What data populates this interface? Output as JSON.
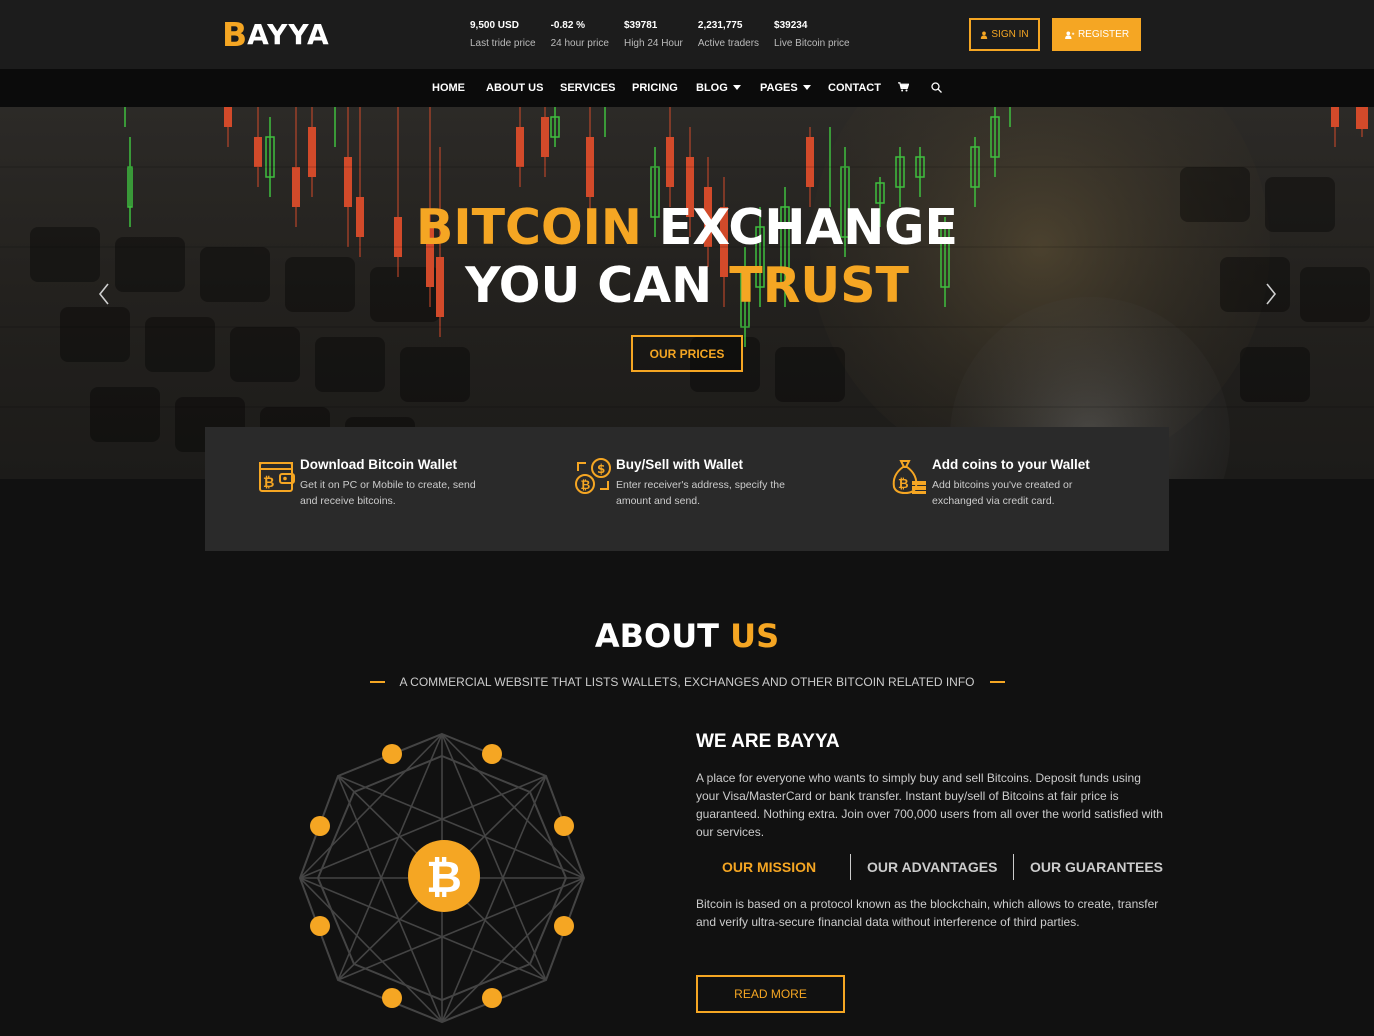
{
  "brand": {
    "logo_b": "B",
    "logo_rest": "AYYA",
    "accent": "#f5a623"
  },
  "stats": [
    {
      "value": "9,500 USD",
      "label": "Last tride price"
    },
    {
      "value": "-0.82 %",
      "label": "24 hour price"
    },
    {
      "value": "$39781",
      "label": "High 24 Hour"
    },
    {
      "value": "2,231,775",
      "label": "Active traders"
    },
    {
      "value": "$39234",
      "label": "Live Bitcoin price"
    }
  ],
  "auth": {
    "signin": "SIGN IN",
    "register": "REGISTER",
    "signin_icon": "user-icon",
    "register_icon": "user-plus-icon"
  },
  "nav": {
    "items": [
      "HOME",
      "ABOUT US",
      "SERVICES",
      "PRICING",
      "BLOG",
      "PAGES",
      "CONTACT"
    ],
    "cart_icon": "cart-icon",
    "search_icon": "search-icon"
  },
  "hero": {
    "line1_orange": "BITCOIN",
    "line1_white": "EXCHANGE",
    "line2_white": "YOU CAN",
    "line2_orange": "TRUST",
    "button": "OUR PRICES",
    "prev_icon": "chevron-left-icon",
    "next_icon": "chevron-right-icon"
  },
  "features": [
    {
      "title": "Download Bitcoin Wallet",
      "desc": "Get it on PC or Mobile to create, send and receive bitcoins.",
      "icon": "wallet-icon"
    },
    {
      "title": "Buy/Sell with Wallet",
      "desc": "Enter receiver's address, specify the amount and send.",
      "icon": "exchange-icon"
    },
    {
      "title": "Add coins to your Wallet",
      "desc": "Add bitcoins you've created or exchanged via credit card.",
      "icon": "money-bag-icon"
    }
  ],
  "about": {
    "title_white": "ABOUT",
    "title_orange": "US",
    "subtitle": "A COMMERCIAL WEBSITE THAT LISTS WALLETS, EXCHANGES AND OTHER BITCOIN RELATED INFO",
    "we_title": "WE ARE BAYYA",
    "we_text": "A place for everyone who wants to simply buy and sell Bitcoins. Deposit funds using your Visa/MasterCard or bank transfer. Instant buy/sell of Bitcoins at fair price is guaranteed. Nothing extra. Join over 700,000 users from all over the world satisfied with our services.",
    "tabs": [
      "OUR MISSION",
      "OUR ADVANTAGES",
      "OUR GUARANTEES"
    ],
    "tab_text": "Bitcoin is based on a protocol known as the blockchain, which allows to create, transfer and verify ultra-secure financial data without interference of third parties.",
    "button": "READ MORE",
    "network_symbol": "₿"
  }
}
